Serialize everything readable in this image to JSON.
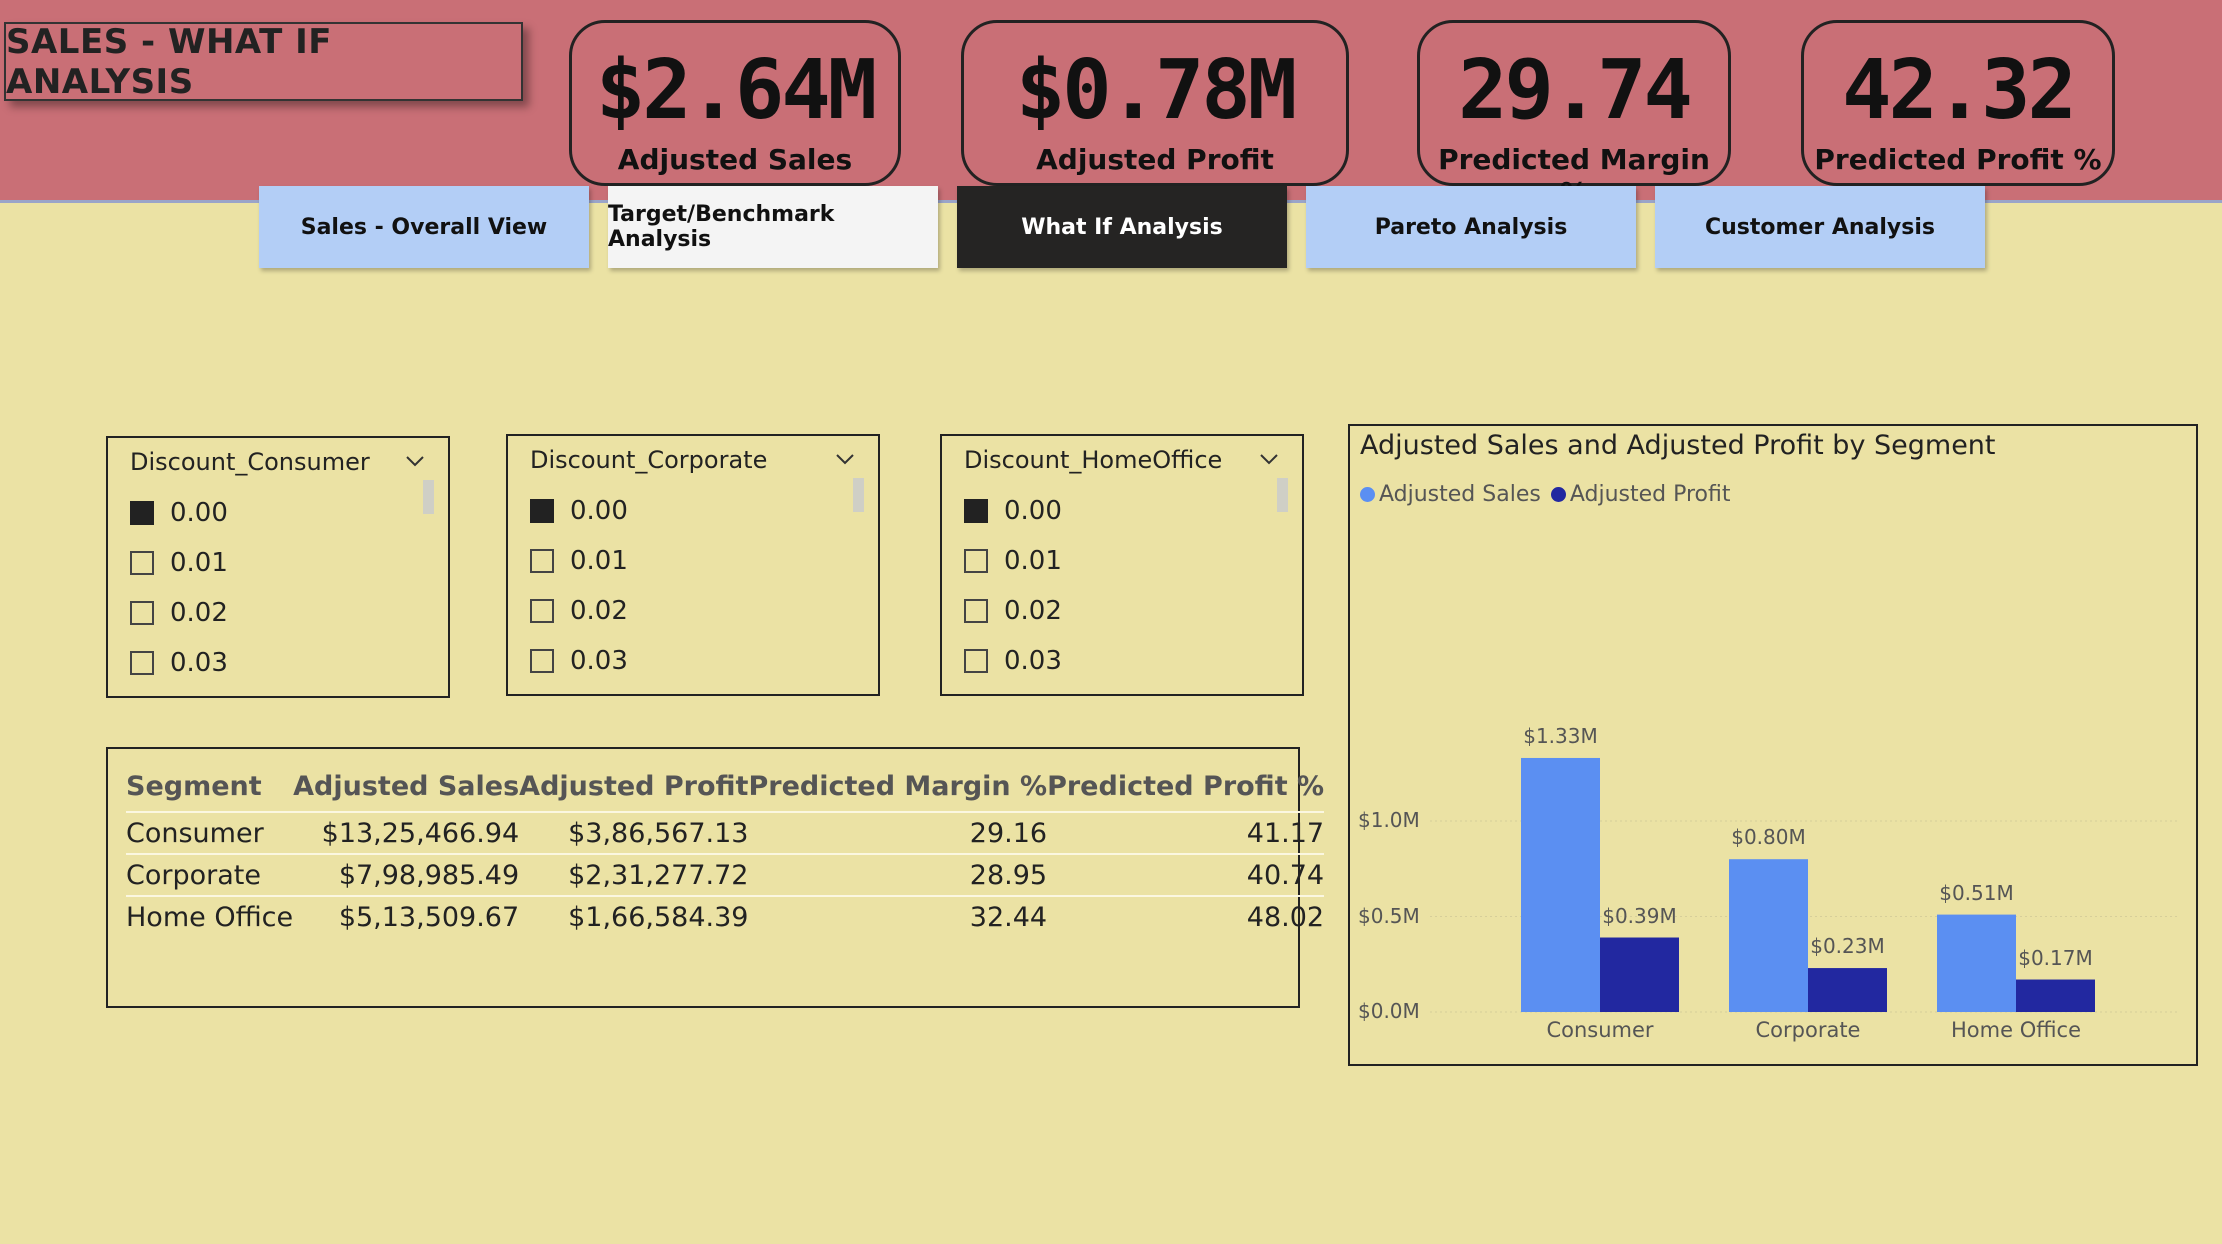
{
  "header": {
    "title": "SALES - WHAT IF ANALYSIS"
  },
  "kpis": [
    {
      "value": "$2.64M",
      "label": "Adjusted Sales"
    },
    {
      "value": "$0.78M",
      "label": "Adjusted Profit"
    },
    {
      "value": "29.74",
      "label": "Predicted Margin %"
    },
    {
      "value": "42.32",
      "label": "Predicted Profit %"
    }
  ],
  "nav": {
    "tabs": [
      {
        "label": "Sales - Overall View",
        "state": "default"
      },
      {
        "label": "Target/Benchmark Analysis",
        "state": "default"
      },
      {
        "label": "What If Analysis",
        "state": "active"
      },
      {
        "label": "Pareto Analysis",
        "state": "default"
      },
      {
        "label": "Customer Analysis",
        "state": "default"
      }
    ]
  },
  "slicers": [
    {
      "title": "Discount_Consumer",
      "options": [
        "0.00",
        "0.01",
        "0.02",
        "0.03"
      ],
      "selected": "0.00"
    },
    {
      "title": "Discount_Corporate",
      "options": [
        "0.00",
        "0.01",
        "0.02",
        "0.03"
      ],
      "selected": "0.00"
    },
    {
      "title": "Discount_HomeOffice",
      "options": [
        "0.00",
        "0.01",
        "0.02",
        "0.03"
      ],
      "selected": "0.00"
    }
  ],
  "table": {
    "columns": [
      "Segment",
      "Adjusted Sales",
      "Adjusted Profit",
      "Predicted Margin %",
      "Predicted Profit %"
    ],
    "rows": [
      [
        "Consumer",
        "$13,25,466.94",
        "$3,86,567.13",
        "29.16",
        "41.17"
      ],
      [
        "Corporate",
        "$7,98,985.49",
        "$2,31,277.72",
        "28.95",
        "40.74"
      ],
      [
        "Home Office",
        "$5,13,509.67",
        "$1,66,584.39",
        "32.44",
        "48.02"
      ]
    ]
  },
  "colors": {
    "header_band": "#c96f76",
    "background": "#ebe2a4",
    "nav_tab": "#b3cef6",
    "nav_active": "#252423",
    "series_sales": "#5b8ff2",
    "series_profit": "#2228a0"
  },
  "chart_data": {
    "type": "bar",
    "title": "Adjusted Sales and Adjusted Profit by Segment",
    "categories": [
      "Consumer",
      "Corporate",
      "Home Office"
    ],
    "series": [
      {
        "name": "Adjusted Sales",
        "values": [
          1.33,
          0.8,
          0.51
        ],
        "labels": [
          "$1.33M",
          "$0.80M",
          "$0.51M"
        ],
        "color": "#5b8ff2"
      },
      {
        "name": "Adjusted Profit",
        "values": [
          0.39,
          0.23,
          0.17
        ],
        "labels": [
          "$0.39M",
          "$0.23M",
          "$0.17M"
        ],
        "color": "#2228a0"
      }
    ],
    "ylim": [
      0,
      1.4
    ],
    "yticks": [
      {
        "value": 0.0,
        "label": "$0.0M"
      },
      {
        "value": 0.5,
        "label": "$0.5M"
      },
      {
        "value": 1.0,
        "label": "$1.0M"
      }
    ],
    "xlabel": "",
    "ylabel": "",
    "legend_position": "top-left",
    "grid": true
  }
}
